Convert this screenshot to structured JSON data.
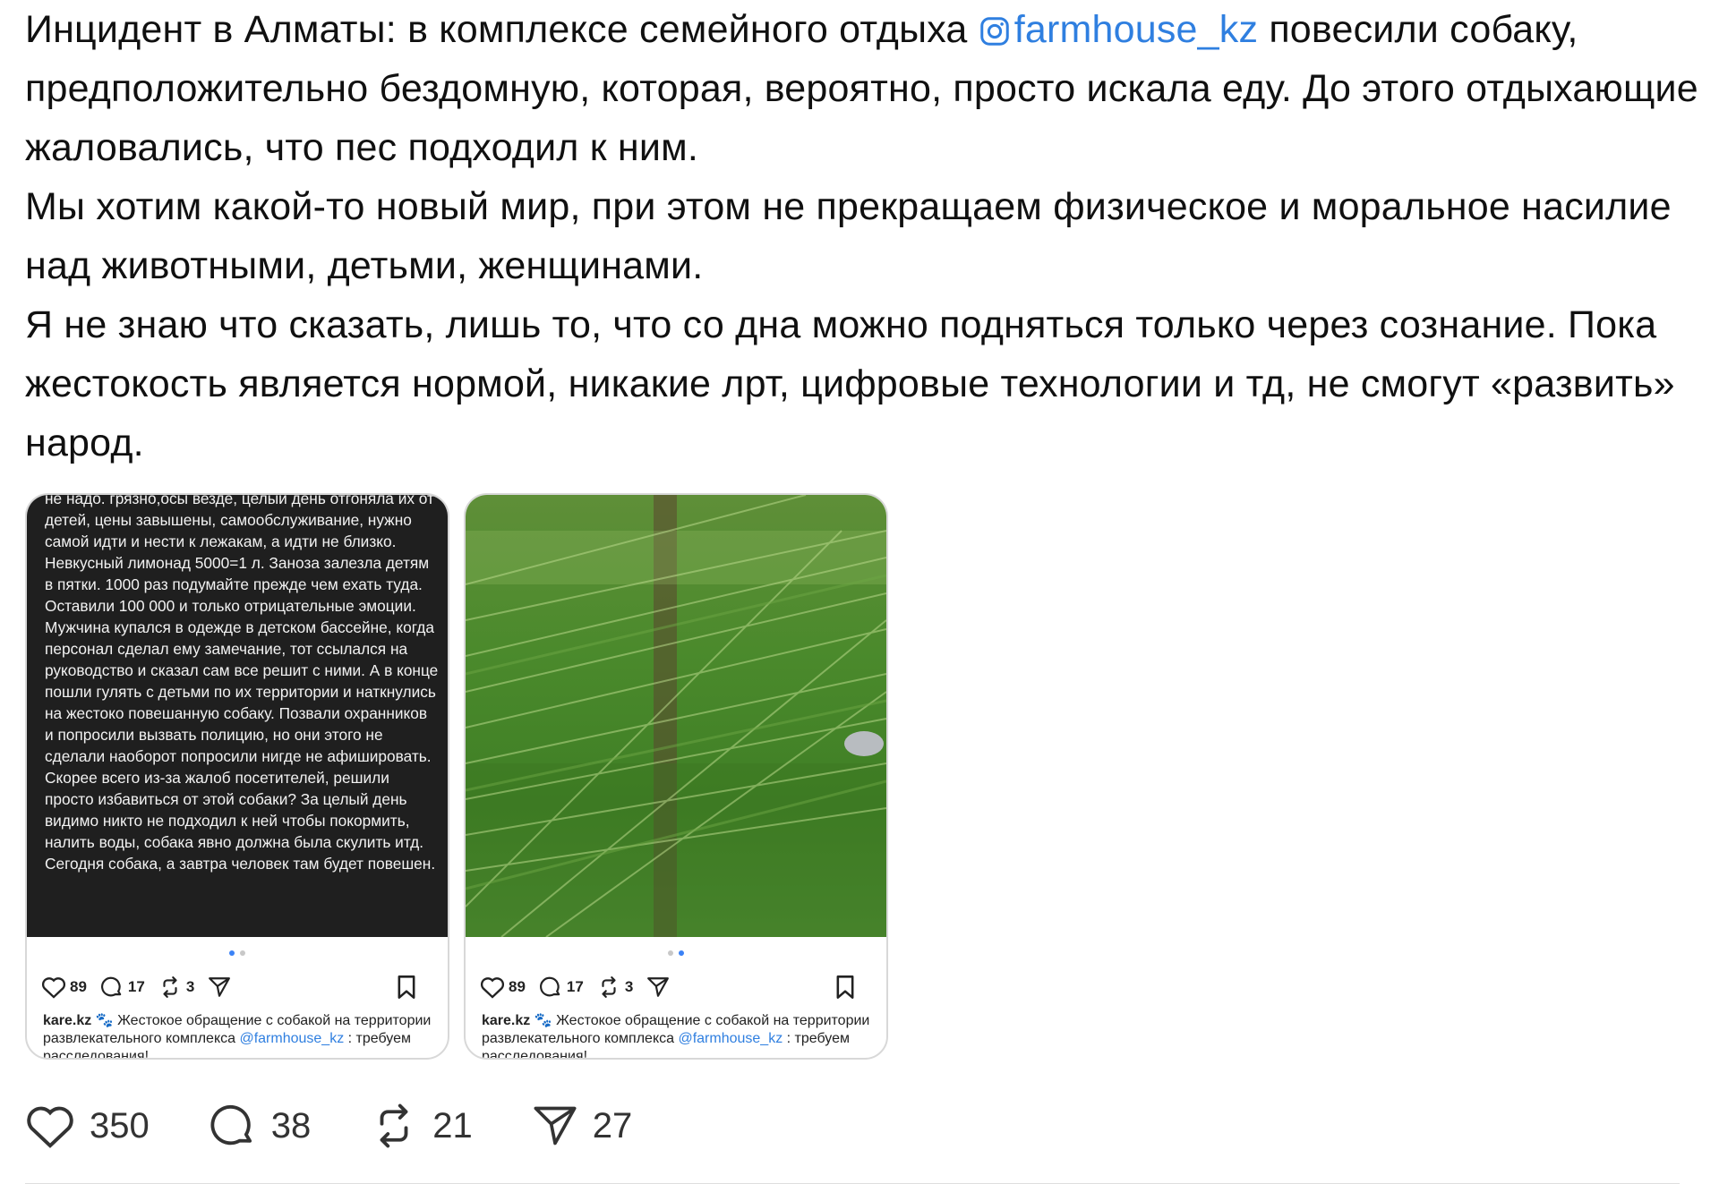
{
  "post": {
    "paragraph1_before": "Инцидент в Алматы: в комплексе семейного отдыха ",
    "mention": "farmhouse_kz",
    "paragraph1_after": " повесили собаку, предположительно бездомную, которая, вероятно, просто искала еду. До этого отдыхающие жаловались, что пес подходил к ним.",
    "paragraph2": "Мы хотим какой-то новый мир, при этом не прекращаем физическое и моральное насилие над животными, детьми, женщинами.",
    "paragraph3": "Я не знаю что сказать, лишь то, что со дна можно подняться только через сознание. Пока жестокость является нормой, никакие лрт, цифровые технологии и тд, не смогут «развить» народ."
  },
  "thumb1": {
    "review_text": "не надо. грязно,осы везде, целый день отгоняла их от детей, цены завышены, самообслуживание, нужно самой идти и нести к лежакам, а идти не близко. Невкусный лимонад 5000=1 л. Заноза залезла детям в пятки. 1000 раз подумайте прежде чем ехать туда. Оставили 100 000 и только отрицательные эмоции. Мужчина купался в одежде в детском бассейне, когда персонал сделал ему замечание, тот ссылался на руководство и сказал сам все решит с ними. А в конце пошли гулять с детьми по их территории и наткнулись на жестоко повешанную собаку. Позвали охранников и попросили вызвать полицию, но они этого не сделали наоборот попросили нигде не афишировать. Скорее всего из-за жалоб посетителей, решили просто избавиться от этой собаки? За целый день видимо никто не подходил к ней чтобы покормить, налить воды, собака явно должна была скулить итд. Сегодня собака, а завтра человек там будет повешен.",
    "likes": "89",
    "comments": "17",
    "reposts": "3",
    "caption_user": "kare.kz",
    "caption_emoji": "🐾",
    "caption_text": " Жестокое обращение с собакой на территории развлекательного комплекса ",
    "caption_link": "@farmhouse_kz",
    "caption_tail": " : требуем расследования!"
  },
  "thumb2": {
    "likes": "89",
    "comments": "17",
    "reposts": "3",
    "caption_user": "kare.kz",
    "caption_emoji": "🐾",
    "caption_text": " Жестокое обращение с собакой на территории развлекательного комплекса ",
    "caption_link": "@farmhouse_kz",
    "caption_tail": " : требуем расследования!"
  },
  "actions": {
    "likes": "350",
    "comments": "38",
    "reposts": "21",
    "shares": "27"
  },
  "colors": {
    "link": "#2f7fe0",
    "text": "#101010",
    "media_dark": "#1f1f1f",
    "grass": "#4b8a2c"
  },
  "icons": [
    "instagram-icon",
    "heart-icon",
    "comment-icon",
    "repost-icon",
    "share-icon",
    "bookmark-icon"
  ]
}
